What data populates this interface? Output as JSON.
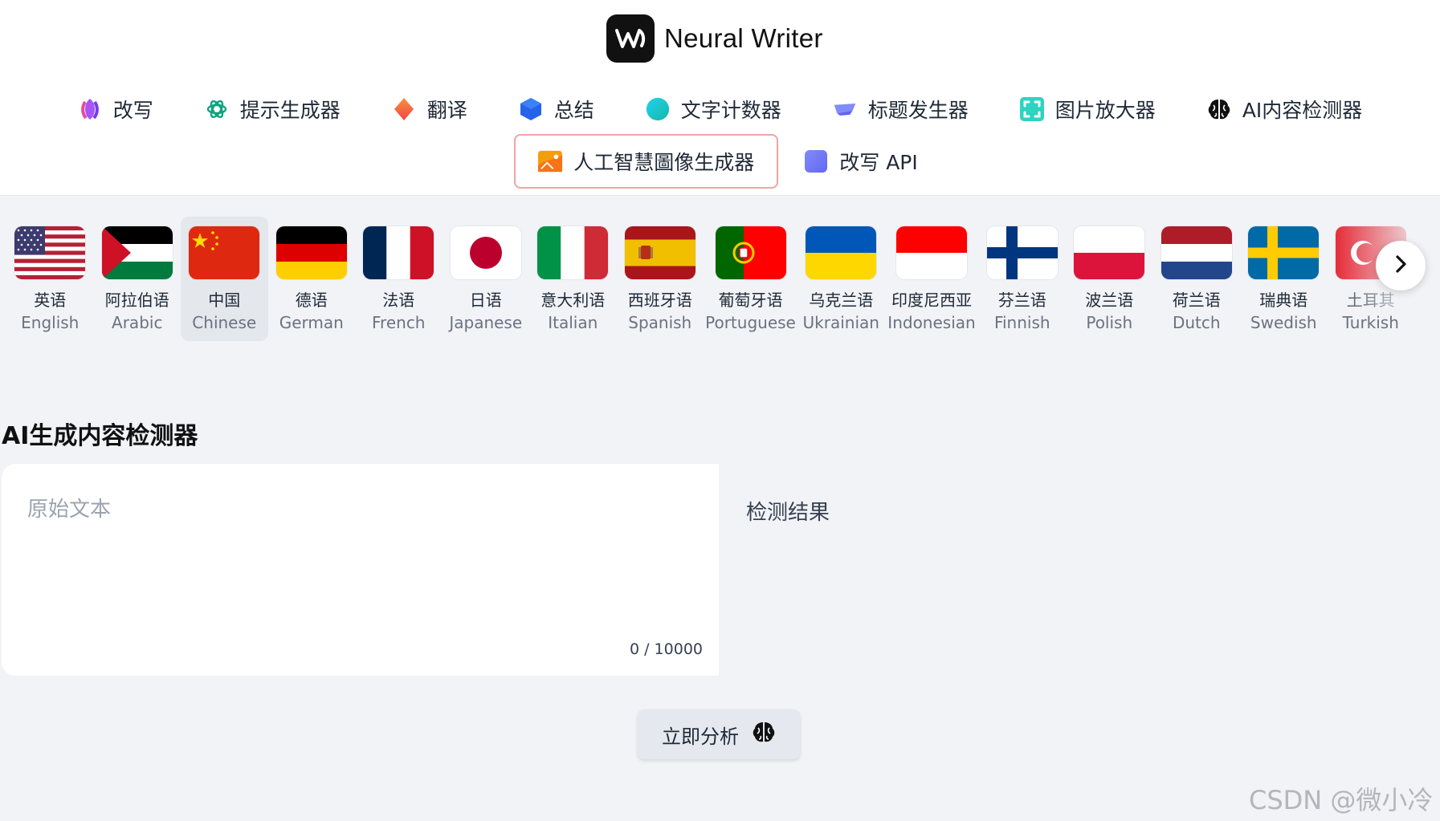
{
  "brand": {
    "name": "Neural Writer"
  },
  "nav": {
    "row1": [
      {
        "label": "改写",
        "icon": "feather-icon"
      },
      {
        "label": "提示生成器",
        "icon": "openai-icon"
      },
      {
        "label": "翻译",
        "icon": "diamond-icon"
      },
      {
        "label": "总结",
        "icon": "cube-icon"
      },
      {
        "label": "文字计数器",
        "icon": "circle-icon"
      },
      {
        "label": "标题发生器",
        "icon": "tag-icon"
      },
      {
        "label": "图片放大器",
        "icon": "expand-icon"
      },
      {
        "label": "AI内容检测器",
        "icon": "brain-icon"
      }
    ],
    "row2": [
      {
        "label": "人工智慧圖像生成器",
        "icon": "image-icon"
      },
      {
        "label": "改写 API",
        "icon": "square-icon"
      }
    ]
  },
  "languages": [
    {
      "native": "英语",
      "english": "English",
      "flag": "us"
    },
    {
      "native": "阿拉伯语",
      "english": "Arabic",
      "flag": "ps"
    },
    {
      "native": "中国",
      "english": "Chinese",
      "flag": "cn"
    },
    {
      "native": "德语",
      "english": "German",
      "flag": "de"
    },
    {
      "native": "法语",
      "english": "French",
      "flag": "fr"
    },
    {
      "native": "日语",
      "english": "Japanese",
      "flag": "jp"
    },
    {
      "native": "意大利语",
      "english": "Italian",
      "flag": "it"
    },
    {
      "native": "西班牙语",
      "english": "Spanish",
      "flag": "es"
    },
    {
      "native": "葡萄牙语",
      "english": "Portuguese",
      "flag": "pt"
    },
    {
      "native": "乌克兰语",
      "english": "Ukrainian",
      "flag": "ua"
    },
    {
      "native": "印度尼西亚",
      "english": "Indonesian",
      "flag": "id"
    },
    {
      "native": "芬兰语",
      "english": "Finnish",
      "flag": "fi"
    },
    {
      "native": "波兰语",
      "english": "Polish",
      "flag": "pl"
    },
    {
      "native": "荷兰语",
      "english": "Dutch",
      "flag": "nl"
    },
    {
      "native": "瑞典语",
      "english": "Swedish",
      "flag": "se"
    },
    {
      "native": "土耳其",
      "english": "Turkish",
      "flag": "tr"
    }
  ],
  "selected_language": "Chinese",
  "main": {
    "title": "AI生成内容检测器",
    "input_placeholder": "原始文本",
    "input_value": "",
    "char_count": "0 / 10000",
    "result_label": "检测结果",
    "analyze_label": "立即分析"
  },
  "watermark": "CSDN @微小冷",
  "colors": {
    "accent_border": "#f3a3a3",
    "selected_bg": "#e4e7ec",
    "page_bg": "#f1f3f7"
  }
}
